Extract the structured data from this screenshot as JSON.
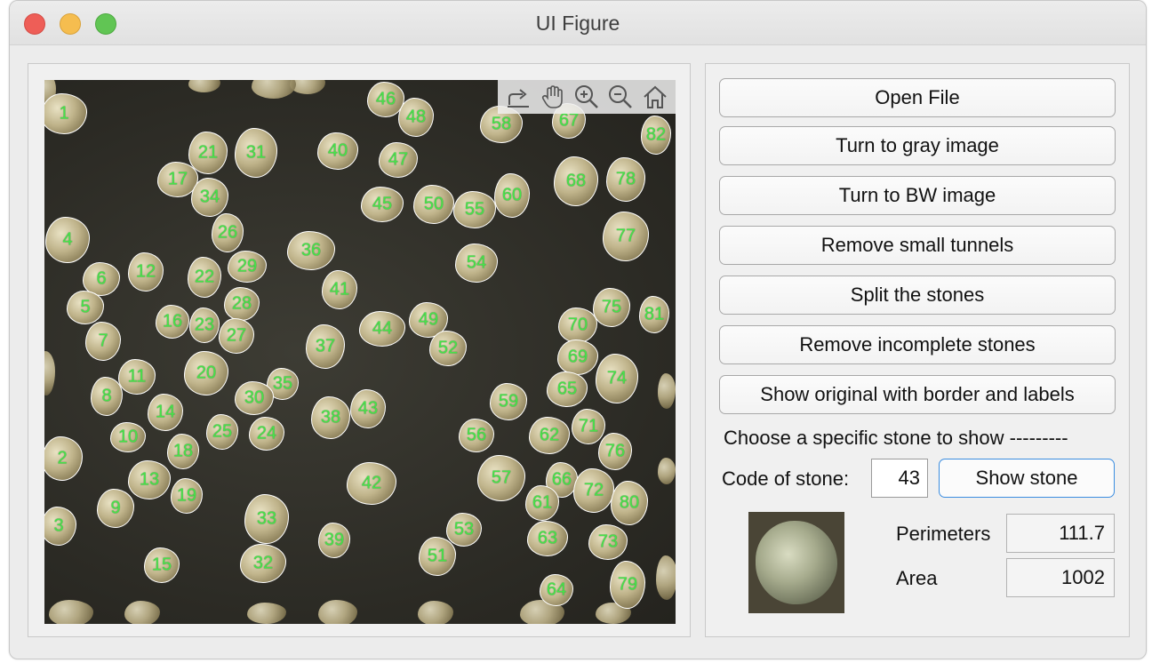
{
  "window": {
    "title": "UI Figure"
  },
  "toolbar_icons": [
    "export-icon",
    "pan-hand-icon",
    "zoom-in-icon",
    "zoom-out-icon",
    "home-icon"
  ],
  "stones": [
    {
      "label": "1"
    },
    {
      "label": "21"
    },
    {
      "label": "31"
    },
    {
      "label": "40"
    },
    {
      "label": "46"
    },
    {
      "label": "48"
    },
    {
      "label": "58"
    },
    {
      "label": "67"
    },
    {
      "label": "82"
    },
    {
      "label": "17"
    },
    {
      "label": "34"
    },
    {
      "label": "47"
    },
    {
      "label": "45"
    },
    {
      "label": "50"
    },
    {
      "label": "55"
    },
    {
      "label": "60"
    },
    {
      "label": "68"
    },
    {
      "label": "78"
    },
    {
      "label": "26"
    },
    {
      "label": "4"
    },
    {
      "label": "36"
    },
    {
      "label": "77"
    },
    {
      "label": "12"
    },
    {
      "label": "6"
    },
    {
      "label": "22"
    },
    {
      "label": "29"
    },
    {
      "label": "54"
    },
    {
      "label": "41"
    },
    {
      "label": "28"
    },
    {
      "label": "5"
    },
    {
      "label": "16"
    },
    {
      "label": "23"
    },
    {
      "label": "44"
    },
    {
      "label": "49"
    },
    {
      "label": "75"
    },
    {
      "label": "81"
    },
    {
      "label": "27"
    },
    {
      "label": "37"
    },
    {
      "label": "70"
    },
    {
      "label": "7"
    },
    {
      "label": "52"
    },
    {
      "label": "69"
    },
    {
      "label": "11"
    },
    {
      "label": "20"
    },
    {
      "label": "35"
    },
    {
      "label": "74"
    },
    {
      "label": "65"
    },
    {
      "label": "8"
    },
    {
      "label": "30"
    },
    {
      "label": "59"
    },
    {
      "label": "14"
    },
    {
      "label": "43"
    },
    {
      "label": "38"
    },
    {
      "label": "71"
    },
    {
      "label": "10"
    },
    {
      "label": "25"
    },
    {
      "label": "24"
    },
    {
      "label": "56"
    },
    {
      "label": "62"
    },
    {
      "label": "18"
    },
    {
      "label": "2"
    },
    {
      "label": "76"
    },
    {
      "label": "13"
    },
    {
      "label": "57"
    },
    {
      "label": "66"
    },
    {
      "label": "42"
    },
    {
      "label": "72"
    },
    {
      "label": "19"
    },
    {
      "label": "9"
    },
    {
      "label": "61"
    },
    {
      "label": "80"
    },
    {
      "label": "33"
    },
    {
      "label": "3"
    },
    {
      "label": "53"
    },
    {
      "label": "63"
    },
    {
      "label": "73"
    },
    {
      "label": "39"
    },
    {
      "label": "51"
    },
    {
      "label": "15"
    },
    {
      "label": "32"
    },
    {
      "label": "79"
    },
    {
      "label": "64"
    }
  ],
  "controls": {
    "open_file": "Open File",
    "gray": "Turn to gray image",
    "bw": "Turn to BW image",
    "remove_tunnels": "Remove small tunnels",
    "split": "Split the stones",
    "remove_incomplete": "Remove incomplete stones",
    "show_original": "Show original with border and labels",
    "choose_heading": "Choose a specific stone to show ---------",
    "code_label": "Code of stone:",
    "code_value": "43",
    "show_stone": "Show stone",
    "perimeters_label": "Perimeters",
    "perimeters_value": "111.7",
    "area_label": "Area",
    "area_value": "1002"
  },
  "colors": {
    "label_green": "#47e24a",
    "focus_blue": "#3b8de0",
    "background_dark": "#2b2a24"
  }
}
